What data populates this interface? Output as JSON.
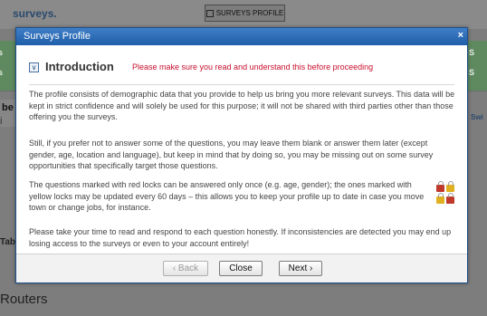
{
  "background": {
    "logo": "surveys.",
    "profile_button": "SURVEYS PROFILE",
    "left_strip_text": "s",
    "right_strip_text": "S",
    "left_heading": "be",
    "left_i": "i",
    "right_link": "Swi",
    "tab_text": "Tab",
    "routers_text": "Routers"
  },
  "modal": {
    "title": "Surveys Profile",
    "close_glyph": "×",
    "section": {
      "collapse_glyph": "∨",
      "title": "Introduction",
      "note": "Please make sure you read and understand this before proceeding"
    },
    "paragraphs": [
      "The profile consists of demographic data that you provide to help us bring you more relevant surveys. This data will be kept in strict confidence and will solely be used for this purpose; it will not be shared with third parties other than those offering you the surveys.",
      "Still, if you prefer not to answer some of the questions, you may leave them blank or answer them later (except gender, age, location and language), but keep in mind that by doing so, you may be missing out on some survey opportunities that specifically target those questions.",
      "The questions marked with red locks can be answered only once (e.g. age, gender); the ones marked with yellow locks may be updated every 60 days – this allows you to keep your profile up to date in case you move town or change jobs, for instance.",
      "Please take your time to read and respond to each question honestly. If inconsistencies are detected you may end up losing access to the surveys or even to your account entirely!"
    ],
    "lock_colors": {
      "red": "#c0392b",
      "yellow": "#e0b020"
    },
    "footer": {
      "back_label": "‹ Back",
      "close_label": "Close",
      "next_label": "Next ›"
    }
  }
}
